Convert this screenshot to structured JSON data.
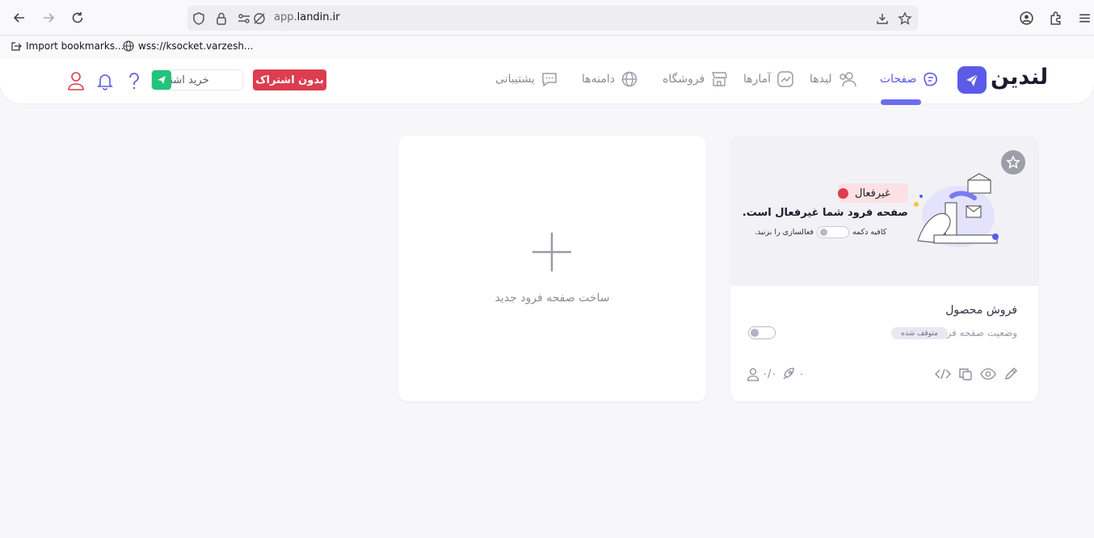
{
  "browser": {
    "url_host": "app.",
    "url_domain": "landin.ir",
    "bookmarks": [
      {
        "label": "Import bookmarks..."
      },
      {
        "label": "wss://ksocket.varzesh..."
      }
    ]
  },
  "header": {
    "logo_text": "لندین",
    "nav": [
      {
        "label": "صفحات",
        "icon": "pages-icon",
        "active": true
      },
      {
        "label": "لیدها",
        "icon": "users-icon"
      },
      {
        "label": "آمارها",
        "icon": "chart-icon"
      },
      {
        "label": "فروشگاه",
        "icon": "store-icon"
      },
      {
        "label": "دامنه‌ها",
        "icon": "globe-icon"
      },
      {
        "label": "پشتیبانی",
        "icon": "chat-icon"
      }
    ],
    "no_subscription_label": "بدون اشتراک",
    "buy_subscription_label": "خرید اشتراک"
  },
  "new_page_card": {
    "label": "ساخت صفحه فرود جدید"
  },
  "page_card": {
    "preview": {
      "badge": "غیرفعال",
      "title": "صفحه فرود شما غیرفعال است.",
      "hint_before": "کافیه دکمه",
      "hint_after": "فعالسازی را بزنید."
    },
    "name": "فروش محصول",
    "status_label": "وضعیت صفحه فرود",
    "status_badge": "متوقف شده",
    "active": false,
    "visits": "۰",
    "leads": "۰/۰"
  },
  "colors": {
    "primary": "#5b5be8",
    "danger": "#dc3d4f",
    "success": "#22c37a"
  }
}
